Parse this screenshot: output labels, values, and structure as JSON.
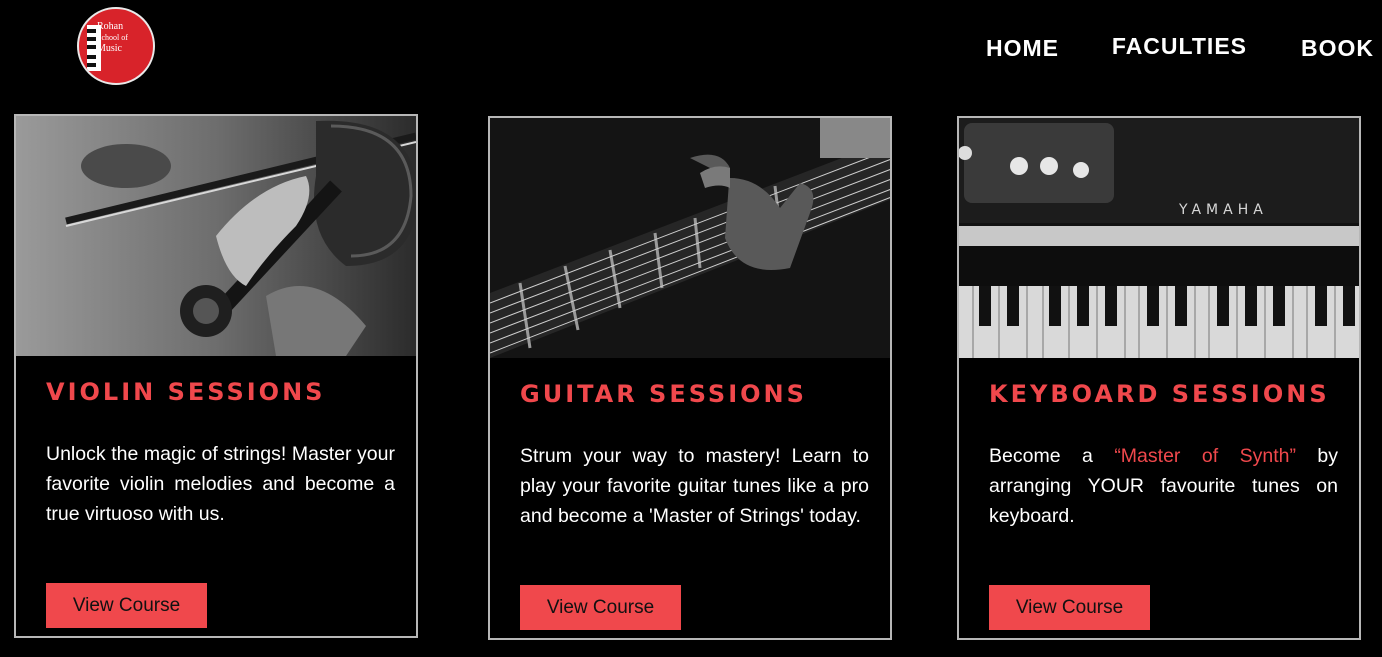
{
  "header": {
    "logo_text": [
      "Rohan",
      "School of",
      "Music"
    ],
    "nav": [
      {
        "label": "HOME"
      },
      {
        "label": "FACULTIES"
      },
      {
        "label": "BOOK"
      }
    ]
  },
  "colors": {
    "accent": "#f0484c",
    "background": "#000000",
    "border": "#b7b7b7",
    "logo_red": "#d8232a"
  },
  "cards": [
    {
      "image_icon": "violin-photo",
      "title": "VIOLIN SESSIONS",
      "desc": "Unlock the magic of strings! Master your favorite violin melodies and become a true virtuoso with us.",
      "button": "View Course"
    },
    {
      "image_icon": "guitar-photo",
      "title": "GUITAR SESSIONS",
      "desc": "Strum your way to mastery! Learn to play your favorite guitar tunes like a pro and become a 'Master of Strings' today.",
      "button": "View Course"
    },
    {
      "image_icon": "keyboard-photo",
      "title": "KEYBOARD SESSIONS",
      "desc_before": "Become a ",
      "desc_highlight": "“Master of Synth”",
      "desc_after": " by arranging YOUR favourite tunes on keyboard.",
      "brand_text": "YAMAHA",
      "button": "View Course"
    }
  ]
}
